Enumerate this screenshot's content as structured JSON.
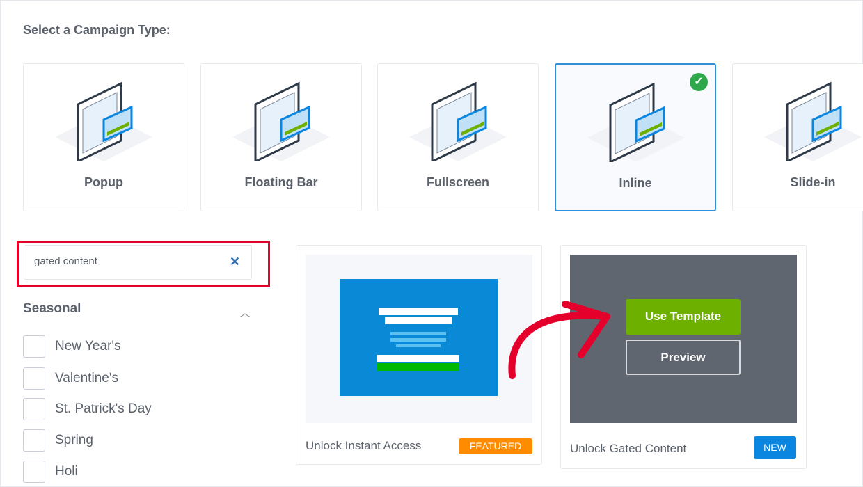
{
  "heading": "Select a Campaign Type:",
  "campaign_types": [
    {
      "label": "Popup",
      "selected": false
    },
    {
      "label": "Floating Bar",
      "selected": false
    },
    {
      "label": "Fullscreen",
      "selected": false
    },
    {
      "label": "Inline",
      "selected": true
    },
    {
      "label": "Slide-in",
      "selected": false
    }
  ],
  "search": {
    "value": "gated content",
    "clear_icon": "close-icon"
  },
  "filters": {
    "section": "Seasonal",
    "items": [
      "New Year's",
      "Valentine's",
      "St. Patrick's Day",
      "Spring",
      "Holi"
    ]
  },
  "templates": [
    {
      "name": "Unlock Instant Access",
      "badge": "FEATURED",
      "badge_color": "#ff8c00"
    },
    {
      "name": "Unlock Gated Content",
      "badge": "NEW",
      "badge_color": "#0a86e0",
      "use_label": "Use Template",
      "preview_label": "Preview"
    }
  ],
  "colors": {
    "accent": "#2f8fd8",
    "green": "#6db000",
    "annotation": "#e4002b"
  }
}
